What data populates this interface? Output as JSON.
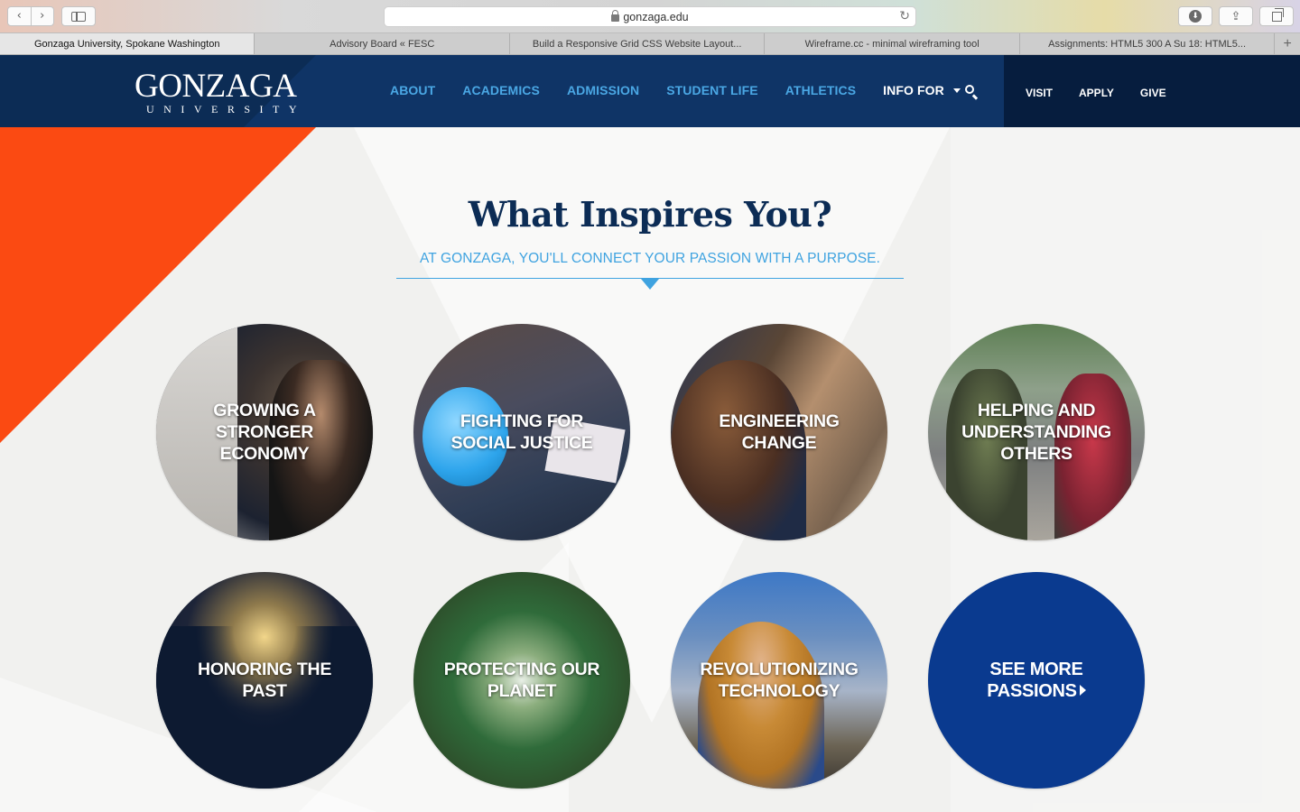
{
  "browser": {
    "url": "gonzaga.edu",
    "nav_back": "‹",
    "nav_forward": "›",
    "reload": "↻",
    "download": "⬇",
    "share": "⇪",
    "new_tab": "+",
    "tabs": [
      {
        "title": "Gonzaga University, Spokane Washington",
        "active": true
      },
      {
        "title": "Advisory Board « FESC",
        "active": false
      },
      {
        "title": "Build a Responsive Grid CSS Website Layout...",
        "active": false
      },
      {
        "title": "Wireframe.cc - minimal wireframing tool",
        "active": false
      },
      {
        "title": "Assignments: HTML5 300 A Su 18: HTML5...",
        "active": false
      }
    ]
  },
  "header": {
    "logo": {
      "wordmark": "GONZAGA",
      "sub": "UNIVERSITY"
    },
    "nav": {
      "about": "ABOUT",
      "academics": "ACADEMICS",
      "admission": "ADMISSION",
      "student_life": "STUDENT LIFE",
      "athletics": "ATHLETICS",
      "info_for": "INFO FOR"
    },
    "utility": {
      "visit": "VISIT",
      "apply": "APPLY",
      "give": "GIVE"
    }
  },
  "hero": {
    "headline": "What Inspires You?",
    "tagline": "AT GONZAGA, YOU'LL CONNECT YOUR PASSION WITH A PURPOSE.",
    "passions": [
      "GROWING A STRONGER ECONOMY",
      "FIGHTING FOR SOCIAL JUSTICE",
      "ENGINEERING CHANGE",
      "HELPING AND UNDERSTANDING OTHERS",
      "HONORING THE PAST",
      "PROTECTING OUR PLANET",
      "REVOLUTIONIZING TECHNOLOGY"
    ],
    "see_more": "SEE MORE PASSIONS"
  },
  "colors": {
    "navy": "#0c2c55",
    "nav_blue": "#4aa7e4",
    "accent_orange": "#fb4a12",
    "see_more_blue": "#0a3a8f"
  }
}
